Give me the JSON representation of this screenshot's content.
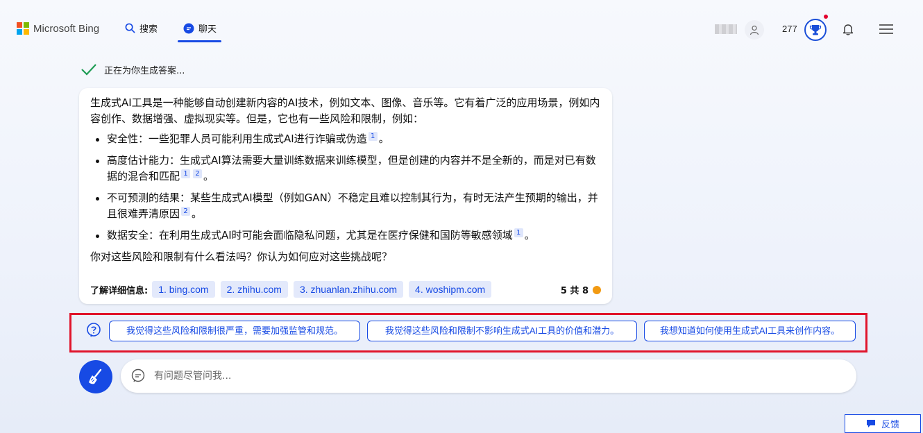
{
  "header": {
    "brand": "Microsoft Bing",
    "tabs": [
      {
        "label": "搜索",
        "icon": "search-icon"
      },
      {
        "label": "聊天",
        "icon": "chat-icon"
      }
    ],
    "points": "277",
    "colors": {
      "accent": "#174ae4",
      "notification": "#e3002d"
    }
  },
  "status": {
    "text": "正在为你生成答案..."
  },
  "answer": {
    "intro": "生成式AI工具是一种能够自动创建新内容的AI技术，例如文本、图像、音乐等。它有着广泛的应用场景，例如内容创作、数据增强、虚拟现实等。但是，它也有一些风险和限制，例如：",
    "bullets": [
      {
        "text": "安全性：一些犯罪人员可能利用生成式AI进行诈骗或伪造",
        "cites": [
          "1"
        ],
        "end": "。"
      },
      {
        "text": "高度估计能力：生成式AI算法需要大量训练数据来训练模型，但是创建的内容并不是全新的，而是对已有数据的混合和匹配",
        "cites": [
          "1",
          "2"
        ],
        "end": "。"
      },
      {
        "text": "不可预测的结果：某些生成式AI模型（例如GAN）不稳定且难以控制其行为，有时无法产生预期的输出，并且很难弄清原因",
        "cites": [
          "2"
        ],
        "end": "。"
      },
      {
        "text": "数据安全：在利用生成式AI时可能会面临隐私问题，尤其是在医疗保健和国防等敏感领域",
        "cites": [
          "1"
        ],
        "end": "。"
      }
    ],
    "question": "你对这些风险和限制有什么看法吗？你认为如何应对这些挑战呢？",
    "learn_more_label": "了解详细信息:",
    "sources": [
      "1. bing.com",
      "2. zhihu.com",
      "3. zhuanlan.zhihu.com",
      "4. woshipm.com"
    ],
    "turn_count": "5 共 8"
  },
  "suggestions": [
    "我觉得这些风险和限制很严重，需要加强监管和规范。",
    "我觉得这些风险和限制不影响生成式AI工具的价值和潜力。",
    "我想知道如何使用生成式AI工具来创作内容。"
  ],
  "input": {
    "placeholder": "有问题尽管问我..."
  },
  "feedback": {
    "label": "反馈"
  }
}
